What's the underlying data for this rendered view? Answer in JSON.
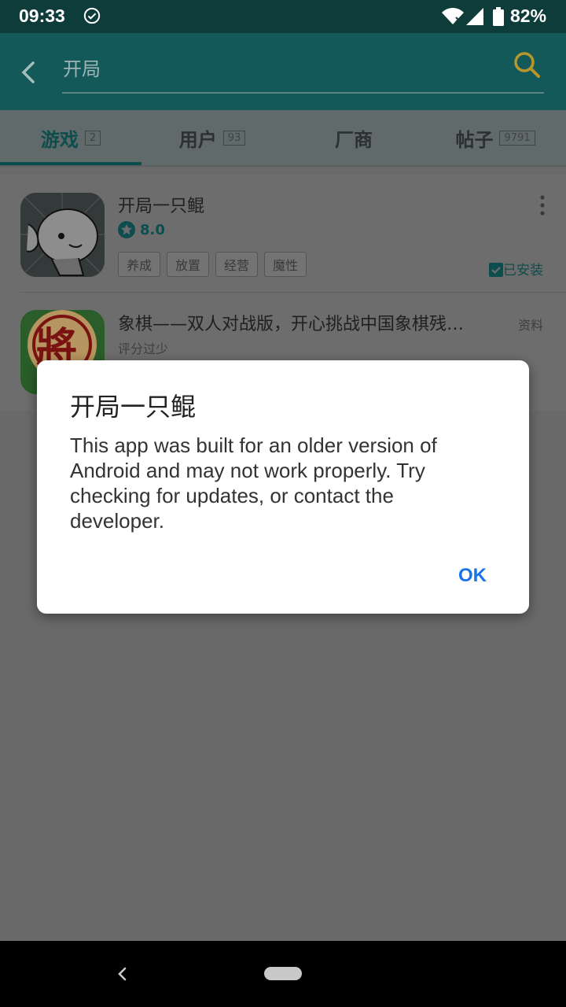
{
  "status_bar": {
    "time": "09:33",
    "battery": "82%"
  },
  "toolbar": {
    "search_value": "开局"
  },
  "tabs": [
    {
      "label": "游戏",
      "count": "2",
      "active": true
    },
    {
      "label": "用户",
      "count": "93"
    },
    {
      "label": "厂商",
      "count": ""
    },
    {
      "label": "帖子",
      "count": "9791"
    }
  ],
  "results": [
    {
      "title": "开局一只鲲",
      "rating": "8.0",
      "tags": [
        "养成",
        "放置",
        "经营",
        "魔性"
      ],
      "status": "已安装"
    },
    {
      "title": "象棋——双人对战版，开心挑战中国象棋残…",
      "rating_text": "评分过少",
      "action": "资料",
      "icon_char": "將"
    }
  ],
  "dialog": {
    "title": "开局一只鲲",
    "message": "This app was built for an older version of Android and may not work properly. Try checking for updates, or contact the developer.",
    "ok_label": "OK"
  },
  "colors": {
    "accent": "#1a73e8",
    "teal": "#13595a",
    "status_bar": "#0e3c3a"
  }
}
